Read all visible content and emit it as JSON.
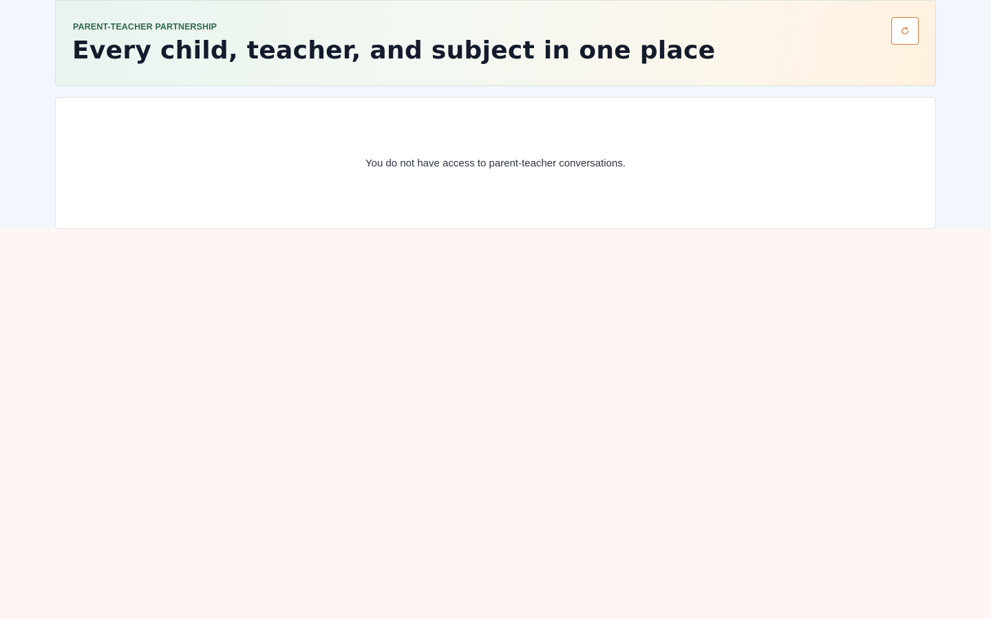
{
  "hero": {
    "eyebrow": "PARENT-TEACHER PARTNERSHIP",
    "title": "Every child, teacher, and subject in one place",
    "refresh_icon": "refresh-icon"
  },
  "notice": {
    "message": "You do not have access to parent-teacher conversations."
  },
  "colors": {
    "accent_green": "#2f6a4f",
    "accent_orange": "#d97a3a",
    "title_text": "#141b2c",
    "page_top": "#f2f6fd",
    "page_bottom": "#fff5f3"
  }
}
